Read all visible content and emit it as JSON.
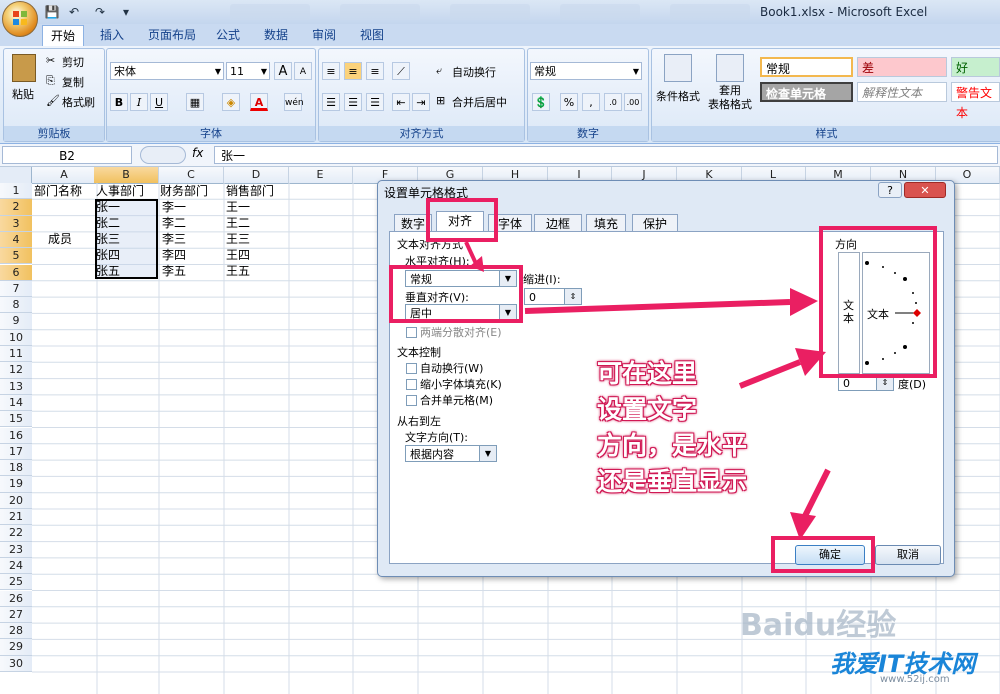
{
  "app": {
    "window_title": "Book1.xlsx - Microsoft Excel"
  },
  "ribbon_tabs": [
    "开始",
    "插入",
    "页面布局",
    "公式",
    "数据",
    "审阅",
    "视图"
  ],
  "clipboard": {
    "paste": "粘贴",
    "cut": "剪切",
    "copy": "复制",
    "format_painter": "格式刷",
    "label": "剪贴板"
  },
  "font": {
    "name": "宋体",
    "size": "11",
    "label": "字体",
    "bold": "B",
    "italic": "I",
    "underline": "U",
    "font_color": "A",
    "grow": "A",
    "shrink": "A"
  },
  "alignment": {
    "wrap": "自动换行",
    "merge": "合并后居中",
    "label": "对齐方式"
  },
  "number": {
    "format": "常规",
    "label": "数字",
    "percent": "%",
    "comma": ","
  },
  "styles": {
    "conditional": "条件格式",
    "table_format": "套用\n表格格式",
    "normal": "常规",
    "bad": "差",
    "good": "好",
    "check_cell": "检查单元格",
    "explanatory": "解释性文本",
    "warning": "警告文本",
    "label": "样式"
  },
  "formula_bar": {
    "name_box": "B2",
    "fx": "fx",
    "value": "张一"
  },
  "columns": [
    "A",
    "B",
    "C",
    "D",
    "E",
    "F",
    "G",
    "H",
    "I",
    "J",
    "K",
    "L",
    "M",
    "N",
    "O"
  ],
  "rows": [
    "1",
    "2",
    "3",
    "4",
    "5",
    "6",
    "7",
    "8",
    "9",
    "10",
    "11",
    "12",
    "13",
    "14",
    "15",
    "16",
    "17",
    "18",
    "19",
    "20",
    "21",
    "22",
    "23",
    "24",
    "25",
    "26",
    "27",
    "28",
    "29",
    "30"
  ],
  "cells": {
    "a1": "部门名称",
    "b1": "人事部门",
    "c1": "财务部门",
    "d1": "销售部门",
    "a4": "成员",
    "b2": "张一",
    "b3": "张二",
    "b4": "张三",
    "b5": "张四",
    "b6": "张五",
    "c2": "李一",
    "c3": "李二",
    "c4": "李三",
    "c5": "李四",
    "c6": "李五",
    "d2": "王一",
    "d3": "王二",
    "d4": "王三",
    "d5": "王四",
    "d6": "王五"
  },
  "dialog": {
    "title": "设置单元格格式",
    "help": "?",
    "close": "✕",
    "tabs": [
      "数字",
      "对齐",
      "字体",
      "边框",
      "填充",
      "保护"
    ],
    "text_alignment": "文本对齐方式",
    "horizontal_label": "水平对齐(H):",
    "horizontal_value": "常规",
    "indent_label": "缩进(I):",
    "indent_value": "0",
    "vertical_label": "垂直对齐(V):",
    "vertical_value": "居中",
    "justify_distributed": "两端分散对齐(E)",
    "text_control": "文本控制",
    "wrap_text": "自动换行(W)",
    "shrink_to_fit": "缩小字体填充(K)",
    "merge_cells": "合并单元格(M)",
    "rtl": "从右到左",
    "text_direction_label": "文字方向(T):",
    "text_direction_value": "根据内容",
    "orientation": "方向",
    "vertical_text": "文本",
    "horizontal_text": "文本",
    "degrees_value": "0",
    "degrees_label": "度(D)",
    "ok": "确定",
    "cancel": "取消"
  },
  "annotation": [
    "可在这里",
    "设置文字",
    "方向，是水平",
    "还是垂直显示"
  ],
  "watermark": {
    "baidu": "Baidu经验",
    "site": "我爱IT技术网",
    "url": "www.52ij.com"
  },
  "colors": {
    "accent": "#ea1f62",
    "ribbon": "#dce8f7",
    "selection": "#f1c15f"
  }
}
